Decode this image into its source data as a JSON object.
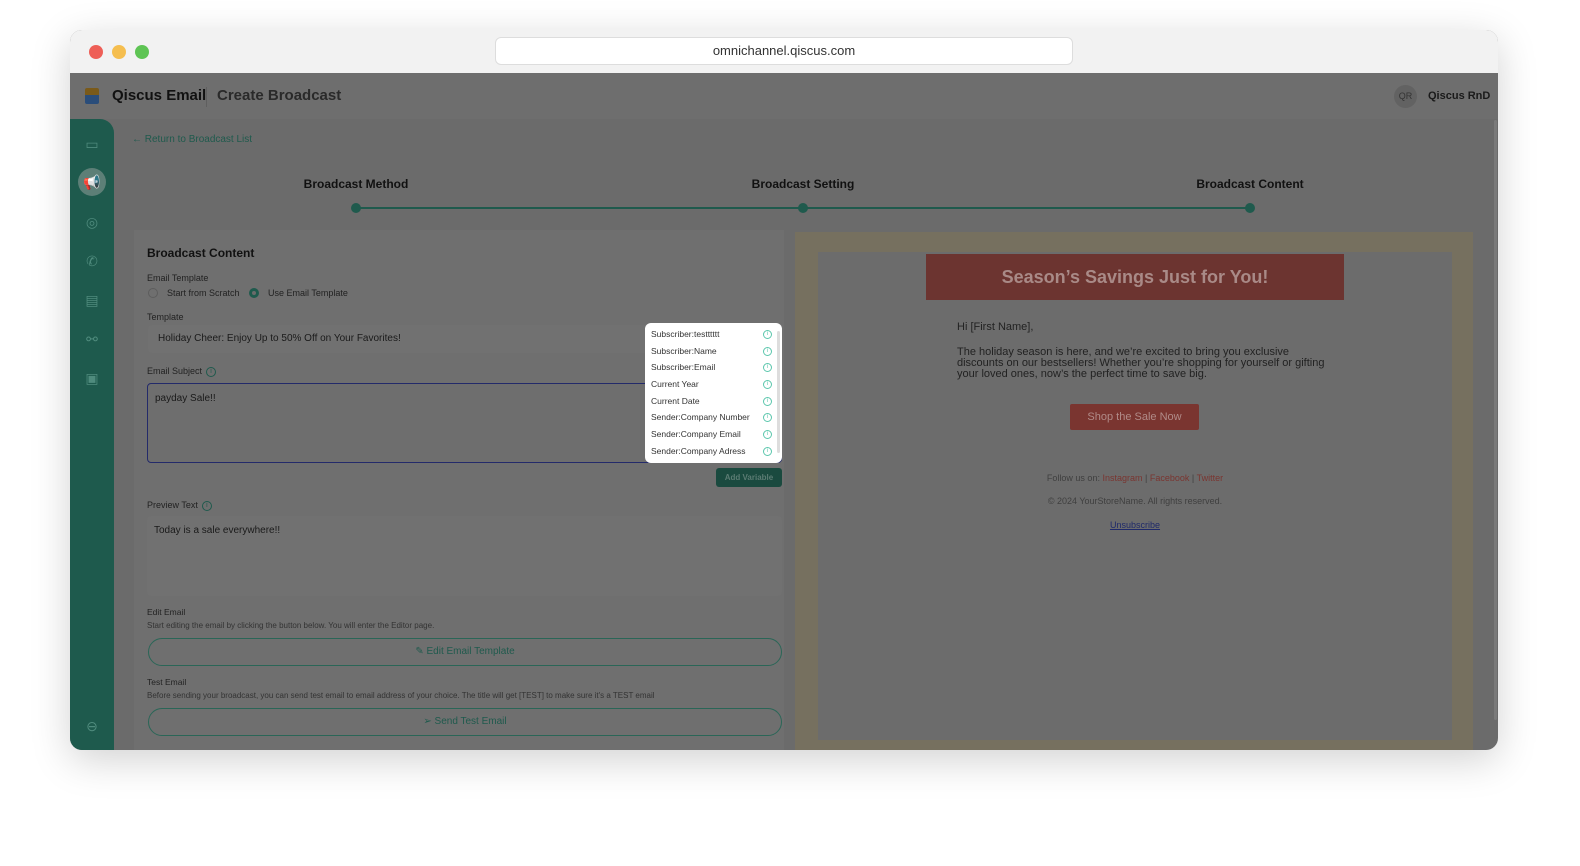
{
  "browser": {
    "url": "omnichannel.qiscus.com"
  },
  "header": {
    "app_name": "Qiscus Email",
    "page_title": "Create Broadcast",
    "avatar_initials": "QR",
    "user_name": "Qiscus RnD"
  },
  "nav": {
    "back": "← Return to Broadcast List"
  },
  "steps": [
    "Broadcast Method",
    "Broadcast Setting",
    "Broadcast Content"
  ],
  "form": {
    "section_title": "Broadcast Content",
    "email_template_label": "Email Template",
    "radio_scratch": "Start from Scratch",
    "radio_template": "Use Email Template",
    "template_label": "Template",
    "template_value": "Holiday Cheer: Enjoy Up to 50% Off on Your Favorites!",
    "subject_label": "Email Subject",
    "subject_value": "payday Sale!!",
    "add_variable": "Add Variable",
    "preview_label": "Preview Text",
    "preview_value": "Today is a sale everywhere!!",
    "edit_label": "Edit Email",
    "edit_desc": "Start editing the email by clicking the button below. You will enter the Editor page.",
    "edit_button": "Edit Email Template",
    "test_label": "Test Email",
    "test_desc": "Before sending your broadcast, you can send test email to email address of your choice. The title will get [TEST] to make sure it's a TEST email",
    "test_button": "Send Test Email"
  },
  "variables": [
    "Subscriber:testttttt",
    "Subscriber:Name",
    "Subscriber:Email",
    "Current Year",
    "Current Date",
    "Sender:Company Number",
    "Sender:Company Email",
    "Sender:Company Adress"
  ],
  "email_preview": {
    "banner": "Season’s Savings Just for You!",
    "greeting": "Hi [First Name],",
    "body": "The holiday season is here, and we’re excited to bring you exclusive discounts on our bestsellers! Whether you’re shopping for yourself or gifting your loved ones, now’s the perfect time to save big.",
    "cta": "Shop the Sale Now",
    "follow": "Follow us on:",
    "instagram": "Instagram",
    "facebook": "Facebook",
    "twitter": "Twitter",
    "pipe": " | ",
    "copyright": "© 2024 YourStoreName. All rights reserved.",
    "unsubscribe": "Unsubscribe"
  }
}
